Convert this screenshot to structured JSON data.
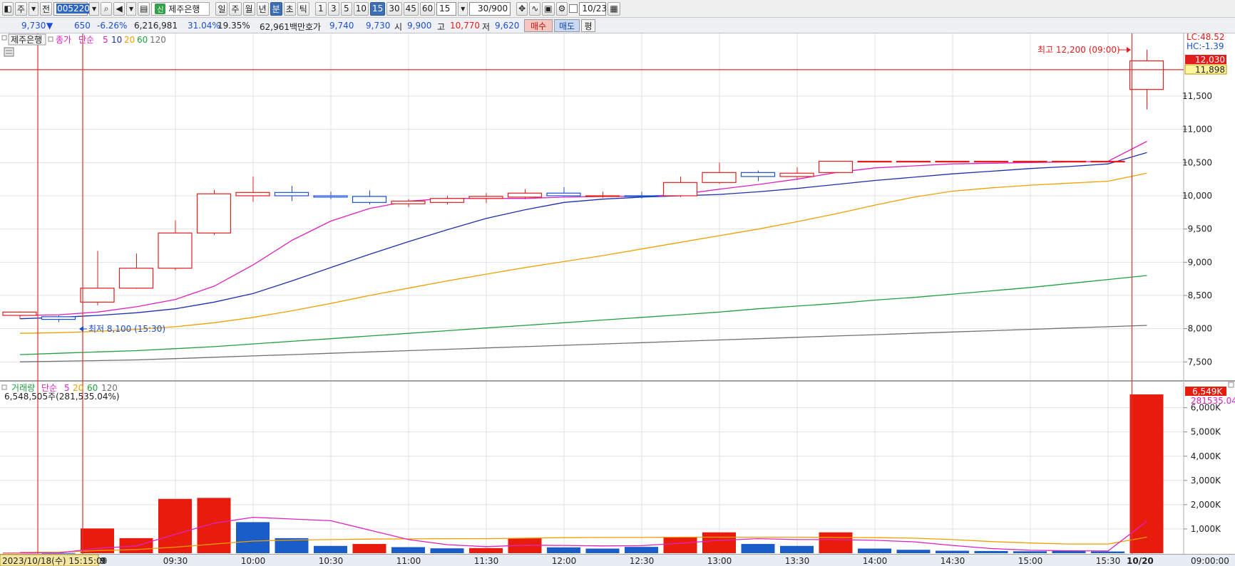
{
  "toolbar": {
    "market_label": "주",
    "range_label": "전",
    "stock_code": "005220",
    "stock_name": "제주은행",
    "badge": "신",
    "period_buttons": [
      "일",
      "주",
      "월",
      "년",
      "분",
      "초",
      "틱"
    ],
    "active_period": "분",
    "minute_buttons": [
      "1",
      "3",
      "5",
      "10",
      "15",
      "30",
      "45",
      "60"
    ],
    "active_minute": "15",
    "interval_value": "15",
    "count_display": "30/900",
    "date_value": "10/23"
  },
  "quote": {
    "price": "9,730",
    "direction_arrow": "▼",
    "change": "650",
    "change_pct": "-6.26%",
    "volume": "6,216,981",
    "turnover_pct": "31.04%",
    "rate2": "19.35%",
    "amount": "62,961백만",
    "hoga_label": "호가",
    "ask": "9,740",
    "bid": "9,730",
    "open_label": "시",
    "open": "9,900",
    "high_label": "고",
    "high": "10,770",
    "low_label": "저",
    "low": "9,620",
    "buy_button": "매수",
    "sell_button": "매도",
    "eval_button": "평"
  },
  "price_pane": {
    "title_box": "제주은행",
    "legend": {
      "close": "종가",
      "simple": "단순",
      "ma": [
        "5",
        "10",
        "20",
        "60",
        "120"
      ]
    },
    "lc_label": "LC:48.52",
    "hc_label": "HC:-1.39",
    "high_annotation": "최고 12,200 (09:00)",
    "low_annotation": "최저 8,100 (15:30)",
    "last_price_label": "12,030",
    "cursor_price_label": "11,898",
    "y_ticks": [
      "11,500",
      "11,000",
      "10,500",
      "10,000",
      "9,500",
      "9,000",
      "8,500",
      "8,000",
      "7,500"
    ]
  },
  "volume_pane": {
    "legend": {
      "title": "거래량",
      "simple": "단순",
      "ma": [
        "5",
        "20",
        "60",
        "120"
      ]
    },
    "volume_readout": "6,548,505주(281,535.04%)",
    "last_volume_label": "6,549K",
    "last_ratio_label": "281535.04",
    "y_ticks": [
      "6,000K",
      "5,000K",
      "4,000K",
      "3,000K",
      "2,000K",
      "1,000K"
    ]
  },
  "x_axis": {
    "cursor_date_label": "2023/10/18(수) 15:15:00",
    "first_label": "9",
    "time_labels": [
      "09:30",
      "10:00",
      "10:30",
      "11:00",
      "11:30",
      "12:00",
      "12:30",
      "13:00",
      "13:30",
      "14:00",
      "14:30",
      "15:00",
      "15:30"
    ],
    "date_label": "10/20",
    "right_label": "09:00:00"
  },
  "colors": {
    "up": "#e31d1d",
    "down": "#1c4fd0",
    "ma5": "#e020c0",
    "ma10": "#1f2fb0",
    "ma20": "#f0a000",
    "ma60": "#20a040",
    "ma120": "#707070",
    "vol_up": "#e81c0c",
    "vol_down": "#1a5cc8",
    "cursor": "#e03030"
  },
  "chart_data": {
    "type": "candlestick",
    "candles": [
      {
        "time": "10/18 15:15",
        "open": 8200,
        "high": 8260,
        "low": 8150,
        "close": 8250
      },
      {
        "time": "10/18 15:30",
        "open": 8180,
        "high": 8200,
        "low": 8100,
        "close": 8140
      },
      {
        "time": "10/19 09:00",
        "open": 8400,
        "high": 9170,
        "low": 8350,
        "close": 8610
      },
      {
        "time": "10/19 09:15",
        "open": 8610,
        "high": 9130,
        "low": 8600,
        "close": 8910
      },
      {
        "time": "10/19 09:30",
        "open": 8910,
        "high": 9630,
        "low": 8880,
        "close": 9440
      },
      {
        "time": "10/19 09:45",
        "open": 9440,
        "high": 10090,
        "low": 9410,
        "close": 10030
      },
      {
        "time": "10/19 10:00",
        "open": 10000,
        "high": 10290,
        "low": 9910,
        "close": 10050
      },
      {
        "time": "10/19 10:15",
        "open": 10050,
        "high": 10150,
        "low": 9920,
        "close": 10000
      },
      {
        "time": "10/19 10:30",
        "open": 10000,
        "high": 10060,
        "low": 9950,
        "close": 9980
      },
      {
        "time": "10/19 10:45",
        "open": 9990,
        "high": 10080,
        "low": 9870,
        "close": 9900
      },
      {
        "time": "10/19 11:00",
        "open": 9880,
        "high": 9950,
        "low": 9830,
        "close": 9920
      },
      {
        "time": "10/19 11:15",
        "open": 9900,
        "high": 10000,
        "low": 9870,
        "close": 9960
      },
      {
        "time": "10/19 11:30",
        "open": 9960,
        "high": 10040,
        "low": 9890,
        "close": 9990
      },
      {
        "time": "10/19 11:45",
        "open": 9980,
        "high": 10100,
        "low": 9950,
        "close": 10040
      },
      {
        "time": "10/19 12:00",
        "open": 10040,
        "high": 10130,
        "low": 9990,
        "close": 10000
      },
      {
        "time": "10/19 12:15",
        "open": 10000,
        "high": 10060,
        "low": 9970,
        "close": 10000
      },
      {
        "time": "10/19 12:30",
        "open": 10000,
        "high": 10060,
        "low": 9960,
        "close": 9990
      },
      {
        "time": "10/19 12:45",
        "open": 10000,
        "high": 10290,
        "low": 9980,
        "close": 10200
      },
      {
        "time": "10/19 13:00",
        "open": 10200,
        "high": 10500,
        "low": 10180,
        "close": 10350
      },
      {
        "time": "10/19 13:15",
        "open": 10350,
        "high": 10380,
        "low": 10220,
        "close": 10290
      },
      {
        "time": "10/19 13:30",
        "open": 10290,
        "high": 10430,
        "low": 10240,
        "close": 10340
      },
      {
        "time": "10/19 13:45",
        "open": 10350,
        "high": 10520,
        "low": 10350,
        "close": 10520
      },
      {
        "time": "10/19 14:00",
        "open": 10520,
        "high": 10520,
        "low": 10520,
        "close": 10520
      },
      {
        "time": "10/19 14:15",
        "open": 10520,
        "high": 10520,
        "low": 10520,
        "close": 10520
      },
      {
        "time": "10/19 14:30",
        "open": 10520,
        "high": 10520,
        "low": 10520,
        "close": 10520
      },
      {
        "time": "10/19 14:45",
        "open": 10520,
        "high": 10520,
        "low": 10520,
        "close": 10520
      },
      {
        "time": "10/19 15:00",
        "open": 10520,
        "high": 10520,
        "low": 10520,
        "close": 10520
      },
      {
        "time": "10/19 15:15",
        "open": 10520,
        "high": 10520,
        "low": 10520,
        "close": 10520
      },
      {
        "time": "10/19 15:30",
        "open": 10520,
        "high": 10520,
        "low": 10520,
        "close": 10520
      },
      {
        "time": "10/20 09:00",
        "open": 11600,
        "high": 12200,
        "low": 11300,
        "close": 12030
      }
    ],
    "ma": {
      "5": [
        8200,
        8210,
        8250,
        8330,
        8440,
        8640,
        8960,
        9330,
        9620,
        9810,
        9920,
        9960,
        9960,
        9960,
        9980,
        9990,
        9990,
        10020,
        10100,
        10170,
        10250,
        10350,
        10420,
        10450,
        10480,
        10490,
        10500,
        10510,
        10520,
        10820
      ],
      "10": [
        8150,
        8170,
        8200,
        8240,
        8300,
        8400,
        8530,
        8720,
        8920,
        9120,
        9310,
        9490,
        9660,
        9790,
        9900,
        9950,
        9980,
        10000,
        10020,
        10060,
        10110,
        10170,
        10230,
        10280,
        10330,
        10370,
        10410,
        10440,
        10480,
        10650
      ],
      "20": [
        7930,
        7940,
        7960,
        7990,
        8030,
        8090,
        8170,
        8270,
        8380,
        8500,
        8610,
        8720,
        8820,
        8920,
        9010,
        9100,
        9200,
        9300,
        9400,
        9500,
        9610,
        9730,
        9860,
        9980,
        10070,
        10120,
        10160,
        10190,
        10220,
        10340
      ],
      "60": [
        7610,
        7630,
        7650,
        7670,
        7700,
        7730,
        7770,
        7810,
        7850,
        7890,
        7930,
        7970,
        8010,
        8050,
        8090,
        8130,
        8170,
        8210,
        8250,
        8300,
        8340,
        8380,
        8430,
        8470,
        8520,
        8570,
        8620,
        8680,
        8740,
        8800
      ],
      "120": [
        7500,
        7510,
        7520,
        7530,
        7550,
        7570,
        7590,
        7610,
        7630,
        7650,
        7670,
        7690,
        7710,
        7730,
        7750,
        7770,
        7790,
        7810,
        7830,
        7850,
        7870,
        7890,
        7910,
        7930,
        7950,
        7970,
        7990,
        8010,
        8030,
        8050
      ]
    },
    "volume": [
      20,
      10,
      1020,
      620,
      2240,
      2280,
      1280,
      620,
      300,
      380,
      250,
      200,
      210,
      620,
      240,
      190,
      260,
      670,
      860,
      380,
      300,
      860,
      190,
      140,
      100,
      90,
      80,
      90,
      70,
      6549
    ],
    "volume_up": [
      true,
      false,
      true,
      true,
      true,
      true,
      false,
      false,
      false,
      true,
      false,
      false,
      true,
      true,
      false,
      false,
      false,
      true,
      true,
      false,
      false,
      true,
      false,
      false,
      false,
      false,
      false,
      false,
      false,
      true
    ],
    "volume_ma5": [
      20,
      15,
      200,
      300,
      780,
      1240,
      1480,
      1410,
      1340,
      950,
      560,
      350,
      270,
      330,
      320,
      300,
      310,
      410,
      530,
      600,
      560,
      560,
      530,
      470,
      320,
      190,
      120,
      100,
      90,
      1320
    ],
    "volume_ma20": [
      30,
      40,
      110,
      150,
      250,
      380,
      500,
      540,
      560,
      580,
      590,
      600,
      600,
      620,
      640,
      650,
      650,
      660,
      660,
      660,
      660,
      650,
      640,
      620,
      560,
      480,
      420,
      380,
      380,
      660
    ],
    "y_range": [
      7300,
      12400
    ],
    "volume_range": [
      0,
      6900
    ]
  }
}
